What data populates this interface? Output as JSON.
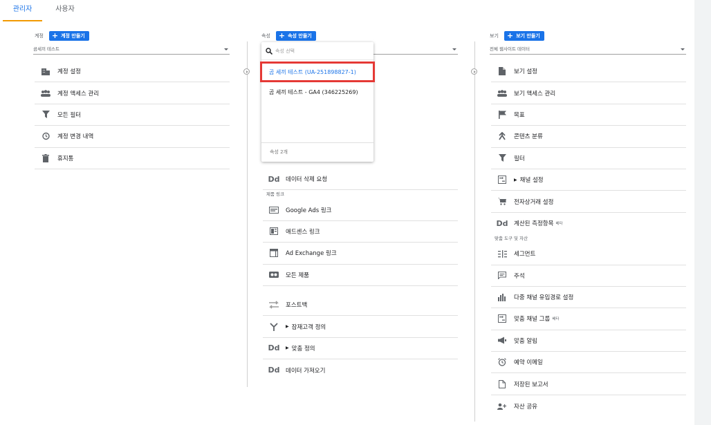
{
  "tabs": [
    {
      "label": "관리자"
    },
    {
      "label": "사용자"
    }
  ],
  "account": {
    "label": "계정",
    "create_button": "계정 만들기",
    "selected": "곰세끼 테스트",
    "items": [
      {
        "label": "계정 설정",
        "icon": "building-icon"
      },
      {
        "label": "계정 액세스 관리",
        "icon": "people-icon"
      },
      {
        "label": "모든 필터",
        "icon": "filter-icon"
      },
      {
        "label": "계정 변경 내역",
        "icon": "history-icon"
      },
      {
        "label": "휴지통",
        "icon": "trash-icon"
      }
    ]
  },
  "property": {
    "label": "속성",
    "create_button": "속성 만들기",
    "items_top": [
      {
        "label": "데이터 삭제 요청",
        "icon": "dd-icon"
      }
    ],
    "section_product_links": "제품 링크",
    "product_links": [
      {
        "label": "Google Ads 링크",
        "icon": "ads-icon"
      },
      {
        "label": "애드센스 링크",
        "icon": "adsense-icon"
      },
      {
        "label": "Ad Exchange 링크",
        "icon": "adexchange-icon"
      },
      {
        "label": "모든 제품",
        "icon": "all-products-icon"
      }
    ],
    "items_bottom": [
      {
        "label": "포스트백",
        "icon": "postback-icon",
        "expand": false
      },
      {
        "label": "잠재고객 정의",
        "icon": "audience-icon",
        "expand": true
      },
      {
        "label": "맞춤 정의",
        "icon": "dd-icon",
        "expand": true
      },
      {
        "label": "데이터 가져오기",
        "icon": "dd-icon",
        "expand": false
      }
    ]
  },
  "property_dropdown": {
    "search_placeholder": "속성 선택",
    "options": [
      {
        "label": "곰 세끼 테스트 (UA-251898827-1)"
      },
      {
        "label": "곰 세끼 테스트 - GA4 (346225269)"
      }
    ],
    "footer": "속성 2개"
  },
  "view": {
    "label": "보기",
    "create_button": "보기 만들기",
    "selected": "전체 웹사이트 데이터",
    "items": [
      {
        "label": "보기 설정",
        "icon": "doc-icon",
        "expand": false,
        "beta": ""
      },
      {
        "label": "보기 액세스 관리",
        "icon": "people-icon",
        "expand": false,
        "beta": ""
      },
      {
        "label": "목표",
        "icon": "flag-icon",
        "expand": false,
        "beta": ""
      },
      {
        "label": "콘텐츠 분류",
        "icon": "merge-icon",
        "expand": false,
        "beta": ""
      },
      {
        "label": "필터",
        "icon": "filter-icon",
        "expand": false,
        "beta": ""
      },
      {
        "label": "채널 설정",
        "icon": "channel-icon",
        "expand": true,
        "beta": ""
      },
      {
        "label": "전자상거래 설정",
        "icon": "cart-icon",
        "expand": false,
        "beta": ""
      },
      {
        "label": "계산된 측정항목",
        "icon": "dd-icon",
        "expand": false,
        "beta": "베타"
      }
    ],
    "section_personal": "맞춤 도구 및 자산",
    "personal": [
      {
        "label": "세그먼트",
        "icon": "segment-icon",
        "beta": ""
      },
      {
        "label": "주석",
        "icon": "comment-icon",
        "beta": ""
      },
      {
        "label": "다중 채널 유입경로 설정",
        "icon": "bar-chart-icon",
        "beta": ""
      },
      {
        "label": "맞춤 채널 그룹",
        "icon": "channel-icon",
        "beta": "베타"
      },
      {
        "label": "맞춤 알림",
        "icon": "megaphone-icon",
        "beta": ""
      },
      {
        "label": "예약 이메일",
        "icon": "alarm-icon",
        "beta": ""
      },
      {
        "label": "저장된 보고서",
        "icon": "report-icon",
        "beta": ""
      },
      {
        "label": "자산 공유",
        "icon": "share-icon",
        "beta": ""
      }
    ]
  }
}
